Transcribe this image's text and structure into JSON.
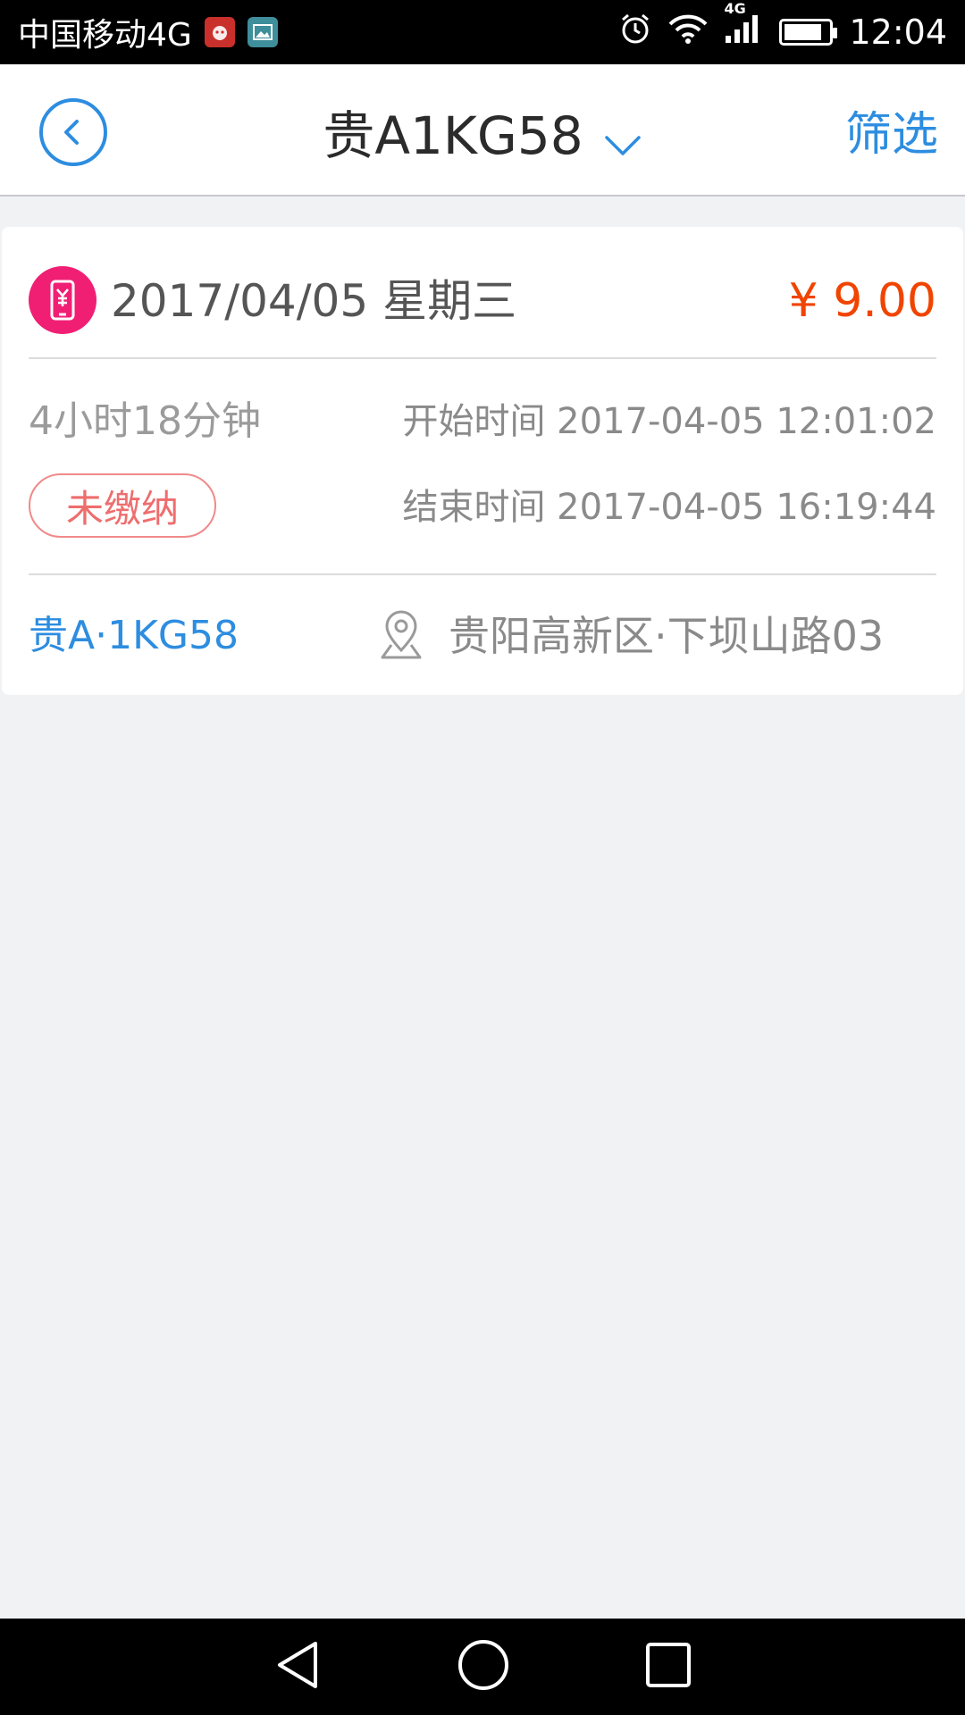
{
  "status_bar": {
    "carrier": "中国移动4G",
    "network": "4G",
    "time": "12:04",
    "battery_level": 0.85
  },
  "header": {
    "title": "贵A1KG58",
    "filter_label": "筛选"
  },
  "record": {
    "date": "2017/04/05 星期三",
    "amount": "¥ 9.00",
    "duration": "4小时18分钟",
    "start_time": "开始时间 2017-04-05 12:01:02",
    "end_time": "结束时间 2017-04-05 16:19:44",
    "status": "未缴纳",
    "plate": "贵A·1KG58",
    "location": "贵阳高新区·下坝山路03"
  },
  "colors": {
    "accent": "#2d8de0",
    "amount": "#f04400",
    "unpaid": "#ee6e6e",
    "pay_icon": "#f01f74"
  },
  "icons": {
    "back": "chevron-left-circle-icon",
    "dropdown": "chevron-down-icon",
    "pay": "phone-yen-icon",
    "location": "map-pin-icon",
    "nav_back": "triangle-back-icon",
    "nav_home": "circle-home-icon",
    "nav_recent": "square-recent-icon"
  }
}
